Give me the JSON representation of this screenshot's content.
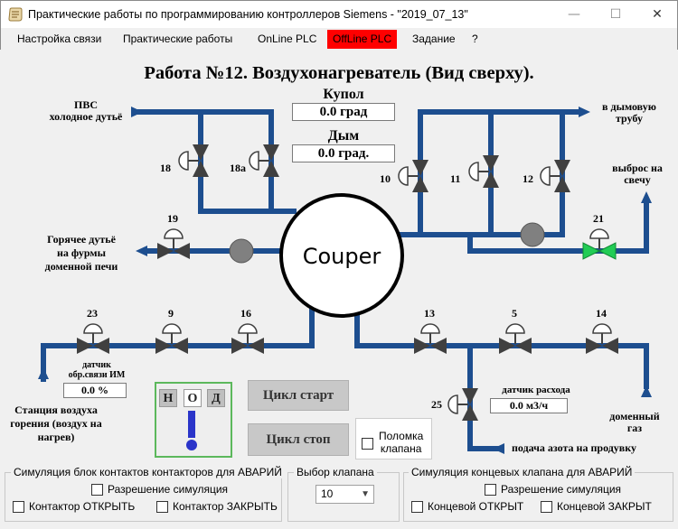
{
  "window": {
    "title": "Практические работы по программированию контроллеров Siemens - \"2019_07_13\"",
    "controls": {
      "minimize": "—",
      "maximize": "☐",
      "close": "✕"
    }
  },
  "menu": {
    "items": [
      "Настройка связи",
      "Практические работы",
      "OnLine PLC",
      "OffLine PLC",
      "Задание",
      "?"
    ],
    "active_color": "#ff0000"
  },
  "diagram": {
    "title": "Работа №12. Воздухонагреватель (Вид сверху).",
    "colors": {
      "pipe": "#1d4e8f",
      "valve_closed": "#404040",
      "valve_open": "#22cc55",
      "sensor_gray": "#808080"
    },
    "cowper_label": "Couper",
    "dome": {
      "label": "Купол",
      "value": "0.0 град"
    },
    "smoke": {
      "label": "Дым",
      "value": "0.0 град."
    },
    "inlets": {
      "cold_blast": [
        "ПВС",
        "холодное дутьё"
      ],
      "hot_blast": [
        "Горячее дутьё",
        "на фурмы",
        "доменной печи"
      ],
      "chimney": [
        "в дымовую",
        "трубу"
      ],
      "candle": [
        "выброс на",
        "свечу"
      ],
      "combustion_station": [
        "Станция воздуха",
        "горения (воздух на",
        "нагрев)"
      ],
      "blast_gas": [
        "доменный",
        "газ"
      ],
      "nitrogen": "подача азота на продувку"
    },
    "valves": {
      "v18": "18",
      "v18a": "18а",
      "v19": "19",
      "v10": "10",
      "v11": "11",
      "v12": "12",
      "v21": "21",
      "v23": "23",
      "v9": "9",
      "v16": "16",
      "v13": "13",
      "v5": "5",
      "v14": "14",
      "v25": "25"
    },
    "feedback_sensor": {
      "label": [
        "датчик",
        "обр.связи ИМ"
      ],
      "value": "0.0 %"
    },
    "flow_sensor": {
      "label": "датчик расхода",
      "value": "0.0 м3/ч"
    },
    "nod": {
      "letters": [
        "Н",
        "О",
        "Д"
      ],
      "active": "О"
    },
    "buttons": {
      "start": "Цикл старт",
      "stop": "Цикл стоп"
    },
    "valve_fault": {
      "label": [
        "Поломка",
        "клапана"
      ],
      "checked": false
    }
  },
  "bottom": {
    "contactors": {
      "title": "Симуляция блок контактов контакторов для АВАРИЙ",
      "enable": "Разрешение симуляция",
      "open": "Контактор ОТКРЫТЬ",
      "close": "Контактор ЗАКРЫТЬ"
    },
    "valve_select": {
      "title": "Выбор клапана",
      "value": "10"
    },
    "limit_switches": {
      "title": "Симуляция концевых клапана для АВАРИЙ",
      "enable": "Разрешение симуляция",
      "open": "Концевой ОТКРЫТ",
      "close": "Концевой ЗАКРЫТ"
    }
  }
}
